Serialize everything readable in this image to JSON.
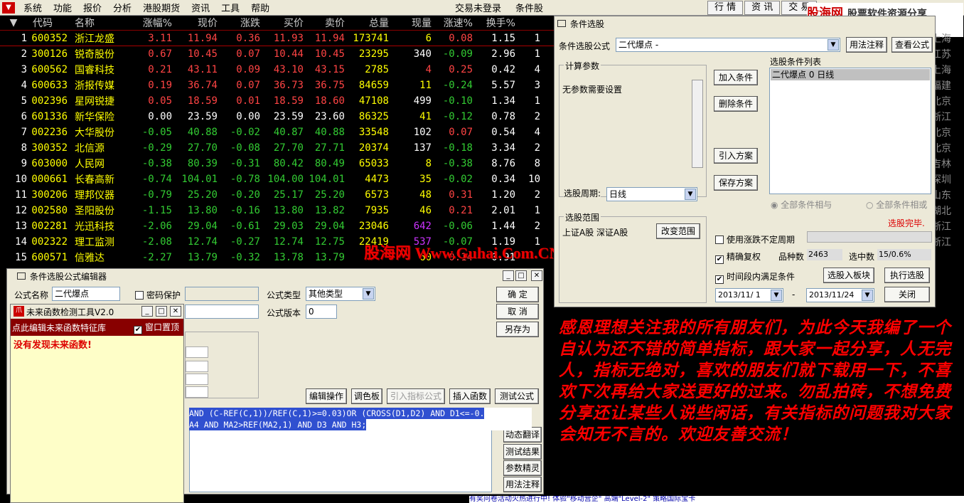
{
  "menubar": {
    "items": [
      "系统",
      "功能",
      "报价",
      "分析",
      "港股期货",
      "资讯",
      "工具",
      "帮助"
    ],
    "status": "交易未登录",
    "condition": "条件股",
    "right_buttons": [
      "行 情",
      "资 讯",
      "交 易"
    ]
  },
  "watermark": {
    "brand_a": "股海网",
    "brand_b": "股票软件资源分享",
    "url": "www.Guhai.com.cn"
  },
  "grid": {
    "headers": [
      "",
      "代码",
      "名称",
      "涨幅%",
      "现价",
      "涨跌",
      "买价",
      "卖价",
      "总量",
      "现量",
      "涨速%",
      "换手%",
      ""
    ],
    "rows": [
      [
        "1",
        "600352",
        "浙江龙盛",
        "3.11",
        "11.94",
        "0.36",
        "11.93",
        "11.94",
        "173741",
        "6",
        "0.08",
        "1.15",
        "1"
      ],
      [
        "2",
        "300126",
        "锐奇股份",
        "0.67",
        "10.45",
        "0.07",
        "10.44",
        "10.45",
        "23295",
        "340",
        "-0.09",
        "2.96",
        "1"
      ],
      [
        "3",
        "600562",
        "国睿科技",
        "0.21",
        "43.11",
        "0.09",
        "43.10",
        "43.15",
        "2785",
        "4",
        "0.25",
        "0.42",
        "4"
      ],
      [
        "4",
        "600633",
        "浙报传媒",
        "0.19",
        "36.74",
        "0.07",
        "36.73",
        "36.75",
        "84659",
        "11",
        "-0.24",
        "5.57",
        "3"
      ],
      [
        "5",
        "002396",
        "星网锐捷",
        "0.05",
        "18.59",
        "0.01",
        "18.59",
        "18.60",
        "47108",
        "499",
        "-0.10",
        "1.34",
        "1"
      ],
      [
        "6",
        "601336",
        "新华保险",
        "0.00",
        "23.59",
        "0.00",
        "23.59",
        "23.60",
        "86325",
        "41",
        "-0.12",
        "0.78",
        "2"
      ],
      [
        "7",
        "002236",
        "大华股份",
        "-0.05",
        "40.88",
        "-0.02",
        "40.87",
        "40.88",
        "33548",
        "102",
        "0.07",
        "0.54",
        "4"
      ],
      [
        "8",
        "300352",
        "北信源",
        "-0.29",
        "27.70",
        "-0.08",
        "27.70",
        "27.71",
        "20374",
        "137",
        "-0.18",
        "3.34",
        "2"
      ],
      [
        "9",
        "603000",
        "人民网",
        "-0.38",
        "80.39",
        "-0.31",
        "80.42",
        "80.49",
        "65033",
        "8",
        "-0.38",
        "8.76",
        "8"
      ],
      [
        "10",
        "000661",
        "长春高新",
        "-0.74",
        "104.01",
        "-0.78",
        "104.00",
        "104.01",
        "4473",
        "35",
        "-0.02",
        "0.34",
        "10"
      ],
      [
        "11",
        "300206",
        "理邦仪器",
        "-0.79",
        "25.20",
        "-0.20",
        "25.17",
        "25.20",
        "6573",
        "48",
        "0.31",
        "1.20",
        "2"
      ],
      [
        "12",
        "002580",
        "圣阳股份",
        "-1.15",
        "13.80",
        "-0.16",
        "13.80",
        "13.82",
        "7935",
        "46",
        "0.21",
        "2.01",
        "1"
      ],
      [
        "13",
        "002281",
        "光迅科技",
        "-2.06",
        "29.04",
        "-0.61",
        "29.03",
        "29.04",
        "23046",
        "642",
        "-0.06",
        "1.44",
        "2"
      ],
      [
        "14",
        "002322",
        "理工监测",
        "-2.08",
        "12.74",
        "-0.27",
        "12.74",
        "12.75",
        "22419",
        "537",
        "-0.07",
        "1.19",
        "1"
      ],
      [
        "15",
        "600571",
        "信雅达",
        "-2.27",
        "13.79",
        "-0.32",
        "13.78",
        "13.79",
        "",
        "60",
        "0.14",
        "0.91",
        ""
      ]
    ],
    "region_col": [
      "上海",
      "江苏",
      "上海",
      "福建",
      "北京",
      "浙江",
      "北京",
      "北京",
      "吉林",
      "深圳",
      "山东",
      "湖北",
      "浙江",
      "浙江"
    ]
  },
  "banner": "股海网 Www.Guhai.Com.CN",
  "selector": {
    "title": "条件选股",
    "formula_label": "条件选股公式",
    "formula_value": "二代爆点 -",
    "usage_btn": "用法注释",
    "view_btn": "查看公式",
    "params_group": "计算参数",
    "params_text": "无参数需要设置",
    "add_btn": "加入条件",
    "delete_btn": "删除条件",
    "import_btn": "引入方案",
    "save_btn": "保存方案",
    "list_title": "选股条件列表",
    "list_item": "二代爆点  0  日线",
    "period_label": "选股周期:",
    "period_value": "日线",
    "all_and": "全部条件相与",
    "all_or": "全部条件相或",
    "status": "选股完毕.",
    "range_group": "选股范围",
    "range_value": "上证A股 深证A股",
    "change_range_btn": "改变范围",
    "uncertain_period": "使用涨跌不定周期",
    "precise": "精确复权",
    "count_label": "品种数",
    "count_value": "2463",
    "selected_label": "选中数",
    "selected_value": "15/0.6%",
    "time_cond": "时间段内满足条件",
    "to_block_btn": "选股入板块",
    "run_btn": "执行选股",
    "date_from": "2013/11/ 1",
    "date_sep": "-",
    "date_to": "2013/11/24",
    "close_btn": "关闭"
  },
  "editor": {
    "title": "条件选股公式编辑器",
    "name_label": "公式名称",
    "name_value": "二代爆点",
    "pwd_label": "密码保护",
    "type_label": "公式类型",
    "type_value": "其他类型",
    "version_label": "公式版本",
    "version_value": "0",
    "ok_btn": "确  定",
    "cancel_btn": "取  消",
    "saveas_btn": "另存为",
    "edit_btn": "编辑操作",
    "palette_btn": "调色板",
    "import_ind_btn": "引入指标公式",
    "insert_fn_btn": "插入函数",
    "test_btn": "测试公式",
    "code_line1": "AND (C-REF(C,1))/REF(C,1)>=0.03)OR (CROSS(D1,D2) AND D1<=-0.",
    "code_line2": "A4 AND MA2>REF(MA2,1)  AND D3 AND H3;",
    "dyn_btn": "动态翻译",
    "result_btn": "测试结果",
    "param_btn": "参数精灵",
    "usage_btn": "用法注释"
  },
  "future": {
    "title": "未来函数检测工具V2.0",
    "bar_text": "点此编辑未来函数特征库",
    "ontop": "窗口置顶",
    "message": "没有发现未来函数!"
  },
  "red_text": "感恩理想关注我的所有朋友们，为此今天我编了一个自认为还不错的简单指标，跟大家一起分享，人无完人，指标无绝对，喜欢的朋友们就下载用一下，不喜欢下次再给大家送更好的过来。勿乱拍砖，不想免费分享还让某些人说些闲话，有关指标的问题我对大家会知无不言的。欢迎友善交流！",
  "ticker": "有奖问卷活动火热进行中!    体验\"移动营企\"    高端\"Level-2\"    策略国际宝卡"
}
